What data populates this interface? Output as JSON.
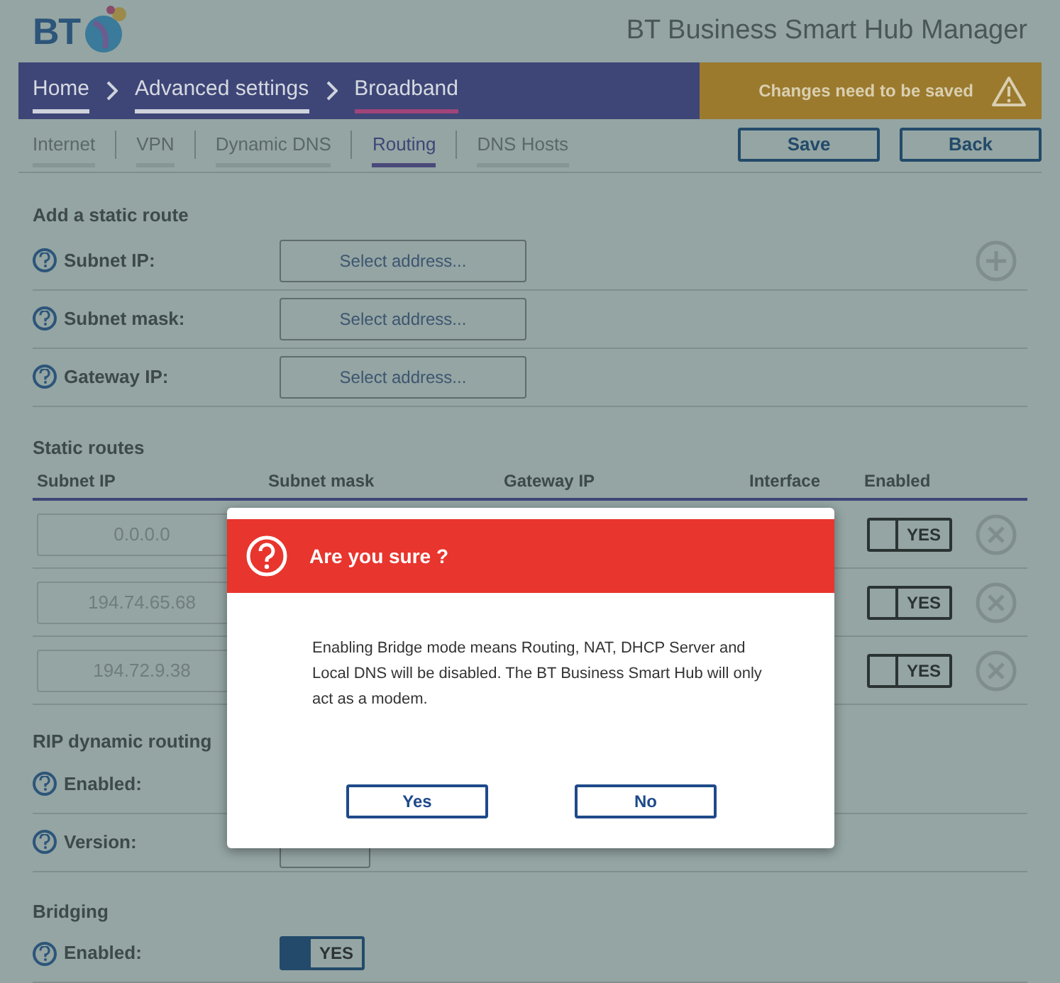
{
  "header": {
    "logo": "BT",
    "title": "BT Business Smart Hub Manager"
  },
  "breadcrumb": [
    {
      "label": "Home",
      "selected": false
    },
    {
      "label": "Advanced settings",
      "selected": false
    },
    {
      "label": "Broadband",
      "selected": true
    }
  ],
  "alert": {
    "text": "Changes need to be saved"
  },
  "tabs": [
    {
      "label": "Internet",
      "selected": false
    },
    {
      "label": "VPN",
      "selected": false
    },
    {
      "label": "Dynamic DNS",
      "selected": false
    },
    {
      "label": "Routing",
      "selected": true
    },
    {
      "label": "DNS Hosts",
      "selected": false
    }
  ],
  "buttons": [
    "Save",
    "Back"
  ],
  "add_route": {
    "title": "Add a static route",
    "fields": [
      {
        "label": "Subnet IP:",
        "placeholder": "Select address..."
      },
      {
        "label": "Subnet mask:",
        "placeholder": "Select address..."
      },
      {
        "label": "Gateway IP:",
        "placeholder": "Select address..."
      }
    ]
  },
  "static_routes": {
    "title": "Static routes",
    "columns": [
      "Subnet IP",
      "Subnet mask",
      "Gateway IP",
      "Interface",
      "Enabled"
    ],
    "rows": [
      {
        "subnet_ip": "0.0.0.0",
        "enabled": true,
        "toggle_label": "YES"
      },
      {
        "subnet_ip": "194.74.65.68",
        "enabled": true,
        "toggle_label": "YES"
      },
      {
        "subnet_ip": "194.72.9.38",
        "enabled": true,
        "toggle_label": "YES"
      }
    ]
  },
  "rip": {
    "title": "RIP dynamic routing",
    "enabled_label": "Enabled:",
    "version_label": "Version:"
  },
  "bridging": {
    "title": "Bridging",
    "enabled_label": "Enabled:",
    "on": true,
    "toggle_label": "YES"
  },
  "dialog": {
    "title": "Are you sure ?",
    "message": "Enabling Bridge mode means Routing, NAT, DHCP Server and Local DNS will be disabled. The BT Business Smart Hub will only act as a modem.",
    "buttons": [
      "Yes",
      "No"
    ]
  }
}
